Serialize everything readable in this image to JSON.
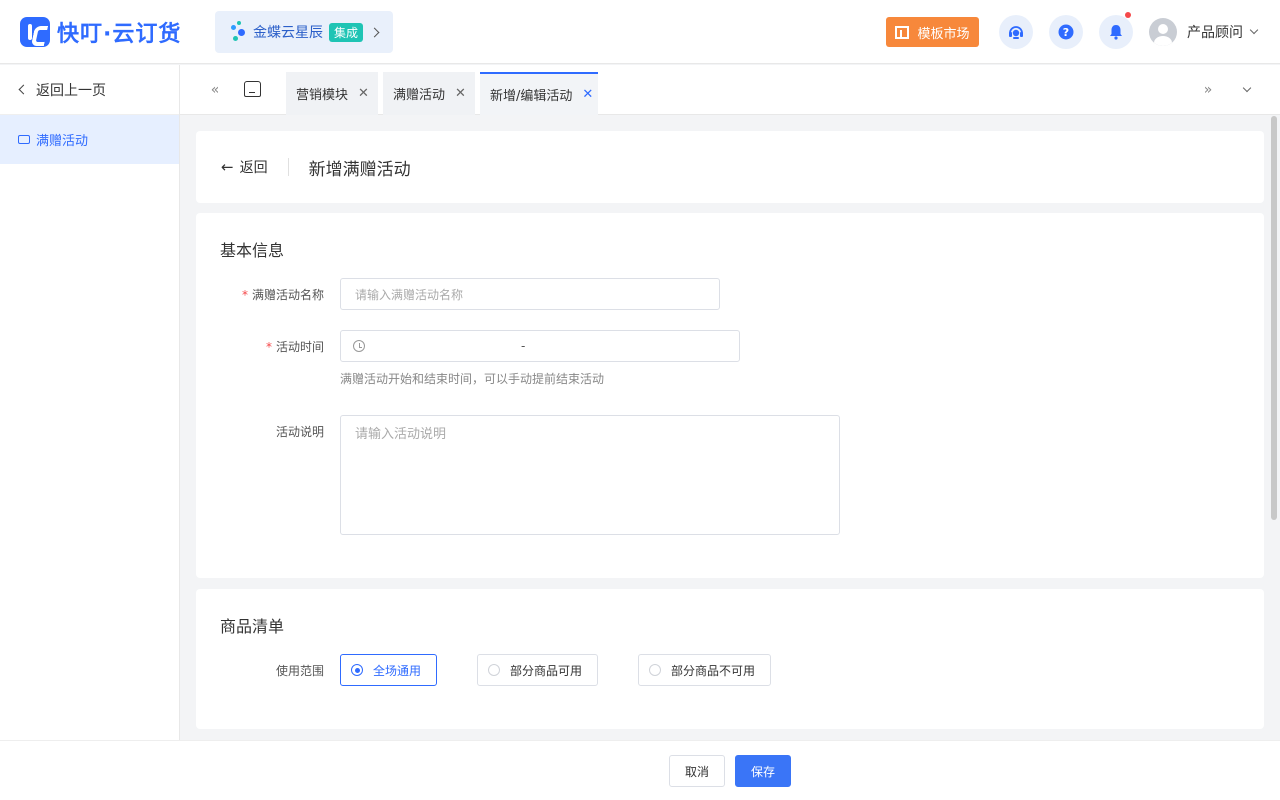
{
  "header": {
    "brand": "快叮·云订货",
    "kd_entry": {
      "text": "金蝶云星辰",
      "badge": "集成"
    },
    "template_market": "模板市场",
    "user_name": "产品顾问",
    "colors": {
      "brand": "#2f6bff",
      "template": "#f7883b",
      "notify_dot": "#f5484a"
    }
  },
  "sidebar": {
    "back_label": "返回上一页",
    "items": [
      {
        "label": "满赠活动",
        "icon": "ticket-icon",
        "active": true
      }
    ]
  },
  "tabs": [
    {
      "label": "营销模块",
      "active": false
    },
    {
      "label": "满赠活动",
      "active": false
    },
    {
      "label": "新增/编辑活动",
      "active": true
    }
  ],
  "page_head": {
    "back_label": "返回",
    "title": "新增满赠活动"
  },
  "basic_info": {
    "title": "基本信息",
    "name_label": "满赠活动名称",
    "name_placeholder": "请输入满赠活动名称",
    "time_label": "活动时间",
    "time_separator": "-",
    "time_hint": "满赠活动开始和结束时间，可以手动提前结束活动",
    "desc_label": "活动说明",
    "desc_placeholder": "请输入活动说明"
  },
  "goods_list": {
    "title": "商品清单",
    "scope_label": "使用范围",
    "options": [
      {
        "label": "全场通用",
        "selected": true
      },
      {
        "label": "部分商品可用",
        "selected": false
      },
      {
        "label": "部分商品不可用",
        "selected": false
      }
    ]
  },
  "footer": {
    "cancel": "取消",
    "save": "保存"
  }
}
